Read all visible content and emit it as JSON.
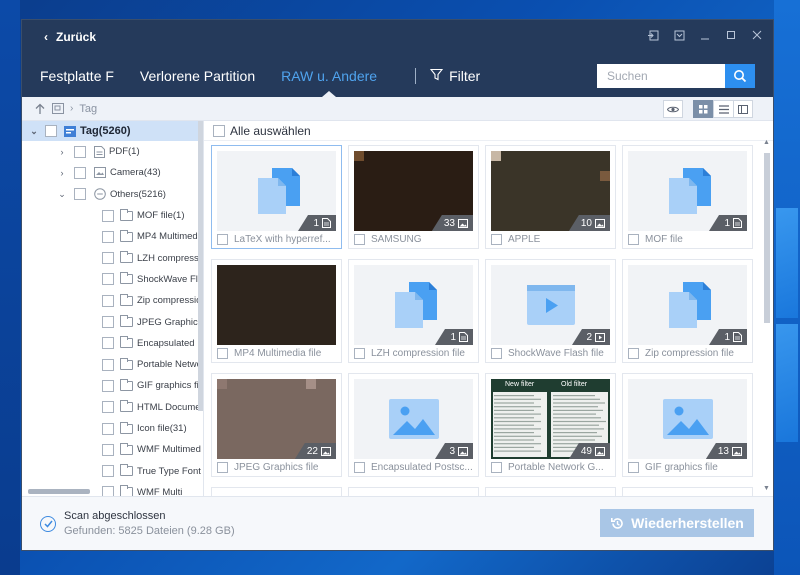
{
  "titlebar": {
    "back_label": "Zurück"
  },
  "nav": {
    "tabs": [
      {
        "label": "Festplatte F",
        "active": false
      },
      {
        "label": "Verlorene Partition",
        "active": false
      },
      {
        "label": "RAW u. Andere",
        "active": true
      }
    ],
    "filter_label": "Filter",
    "search_placeholder": "Suchen"
  },
  "pathbar": {
    "current": "Tag"
  },
  "tree": {
    "root": "Tag(5260)",
    "items": [
      {
        "label": "PDF(1)",
        "level": 1,
        "expand": "collapsed",
        "icon": "pdf-icon"
      },
      {
        "label": "Camera(43)",
        "level": 1,
        "expand": "collapsed",
        "icon": "camera-icon"
      },
      {
        "label": "Others(5216)",
        "level": 1,
        "expand": "expanded",
        "icon": "others-icon"
      },
      {
        "label": "MOF file(1)",
        "level": 2
      },
      {
        "label": "MP4 Multimed",
        "level": 2
      },
      {
        "label": "LZH compressi",
        "level": 2
      },
      {
        "label": "ShockWave Fla",
        "level": 2
      },
      {
        "label": "Zip compressio",
        "level": 2
      },
      {
        "label": "JPEG Graphics f",
        "level": 2
      },
      {
        "label": "Encapsulated P",
        "level": 2
      },
      {
        "label": "Portable Netwo",
        "level": 2
      },
      {
        "label": "GIF graphics file",
        "level": 2
      },
      {
        "label": "HTML Docume",
        "level": 2
      },
      {
        "label": "Icon file(31)",
        "level": 2
      },
      {
        "label": "WMF Multimed",
        "level": 2
      },
      {
        "label": "True Type Font",
        "level": 2
      },
      {
        "label": "WMF Multi",
        "level": 2
      }
    ]
  },
  "main": {
    "select_all_label": "Alle auswählen",
    "cards": [
      {
        "caption": "LaTeX with hyperref...",
        "count": "1",
        "thumb": "doc",
        "badge_icon": "doc"
      },
      {
        "caption": "SAMSUNG",
        "count": "33",
        "thumb": "photo-a",
        "badge_icon": "image"
      },
      {
        "caption": "APPLE",
        "count": "10",
        "thumb": "photo-b",
        "badge_icon": "image"
      },
      {
        "caption": "MOF file",
        "count": "1",
        "thumb": "doc",
        "badge_icon": "doc"
      },
      {
        "caption": "MP4 Multimedia file",
        "count": "",
        "thumb": "photo-c",
        "badge_icon": ""
      },
      {
        "caption": "LZH compression file",
        "count": "1",
        "thumb": "doc",
        "badge_icon": "doc"
      },
      {
        "caption": "ShockWave Flash file",
        "count": "2",
        "thumb": "video",
        "badge_icon": "video"
      },
      {
        "caption": "Zip compression file",
        "count": "1",
        "thumb": "doc",
        "badge_icon": "doc"
      },
      {
        "caption": "JPEG Graphics file",
        "count": "22",
        "thumb": "photo-d",
        "badge_icon": "image"
      },
      {
        "caption": "Encapsulated Postsc...",
        "count": "3",
        "thumb": "image",
        "badge_icon": "image"
      },
      {
        "caption": "Portable Network G...",
        "count": "49",
        "thumb": "screenshot",
        "badge_icon": "image"
      },
      {
        "caption": "GIF graphics file",
        "count": "13",
        "thumb": "image",
        "badge_icon": "image"
      }
    ],
    "screenshot_thumb": {
      "left_label": "New filter",
      "right_label": "Old filter"
    }
  },
  "footer": {
    "status_title": "Scan abgeschlossen",
    "status_detail": "Gefunden: 5825 Dateien (9.28 GB)",
    "restore_label": "Wiederherstellen"
  },
  "colors": {
    "titlebar_bg": "#253a5b",
    "accent": "#2d8ff0",
    "active_tab": "#4fa3ee",
    "tree_selected": "#cfe1f7",
    "restore_btn": "#a9c6e6"
  }
}
